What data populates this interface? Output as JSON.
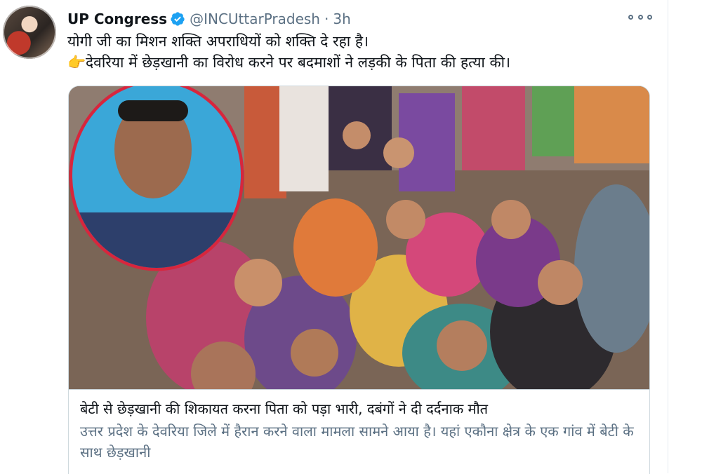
{
  "tweet": {
    "author_name": "UP Congress",
    "author_handle": "@INCUttarPradesh",
    "separator": "·",
    "time": "3h",
    "text_line1": "योगी जी का मिशन शक्ति अपराधियों को शक्ति दे रहा है।",
    "text_line2": "देवरिया में छेड़खानी का विरोध करने पर बदमाशों ने लड़की के पिता की हत्या की।",
    "text_line2_prefix": "👉"
  },
  "card": {
    "title": "बेटी से छेड़खानी की शिकायत करना पिता को पड़ा भारी, दबंगों ने दी दर्दनाक मौत",
    "description": "उत्तर प्रदेश के देवरिया जिले में हैरान करने वाला मामला सामने आया है। यहां एकौना क्षेत्र के एक गांव में बेटी के साथ छेड़खानी"
  },
  "colors": {
    "verified_blue": "#1da1f2",
    "text_primary": "#0f1419",
    "text_secondary": "#5b7083",
    "border": "#cfd9de",
    "inset_frame": "#d7263d"
  },
  "icons": {
    "verified": "verified-badge-icon",
    "more": "more-options-icon",
    "pointing": "backhand-index-pointing-right-icon"
  }
}
